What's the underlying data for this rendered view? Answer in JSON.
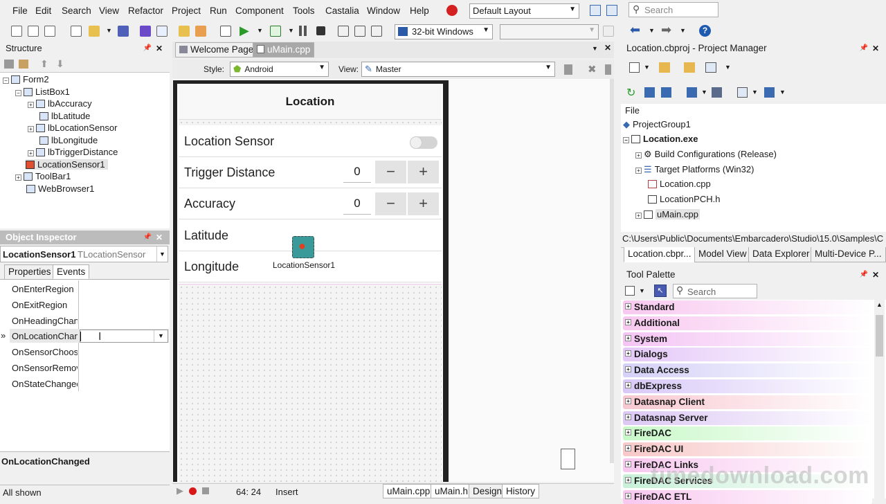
{
  "menubar": {
    "items": [
      "File",
      "Edit",
      "Search",
      "View",
      "Refactor",
      "Project",
      "Run",
      "Component",
      "Tools",
      "Castalia",
      "Window",
      "Help"
    ],
    "layout_combo": "Default Layout",
    "search_placeholder": "Search"
  },
  "toolbar": {
    "platform_combo": "32-bit Windows",
    "config_combo": ""
  },
  "structure": {
    "title": "Structure",
    "nodes": [
      "Form2",
      "ListBox1",
      "lbAccuracy",
      "lbLatitude",
      "lbLocationSensor",
      "lbLongitude",
      "lbTriggerDistance",
      "LocationSensor1",
      "ToolBar1",
      "WebBrowser1"
    ]
  },
  "inspector": {
    "title": "Object Inspector",
    "object_name": "LocationSensor1",
    "object_type": "TLocationSensor",
    "tab_properties": "Properties",
    "tab_events": "Events",
    "events": [
      "OnEnterRegion",
      "OnExitRegion",
      "OnHeadingChan",
      "OnLocationChan",
      "OnSensorChoos",
      "OnSensorRemov",
      "OnStateChangec"
    ],
    "selected_marker": "»",
    "selected_event_label": "OnLocationChanged",
    "status": "All shown"
  },
  "editor": {
    "tab_welcome": "Welcome Page",
    "tab_umain": "uMain.cpp",
    "style_label": "Style:",
    "style_value": "Android",
    "view_label": "View:",
    "view_value": "Master"
  },
  "form": {
    "header": "Location",
    "rows": {
      "location_sensor": "Location Sensor",
      "trigger_distance": "Trigger Distance",
      "trigger_value": "0",
      "accuracy": "Accuracy",
      "accuracy_value": "0",
      "latitude": "Latitude",
      "longitude": "Longitude"
    },
    "minus": "−",
    "plus": "+",
    "component_label": "LocationSensor1"
  },
  "statusbar": {
    "position": "64:  24",
    "mode": "Insert",
    "tabs": [
      "uMain.cpp",
      "uMain.h",
      "Design",
      "History"
    ]
  },
  "project_manager": {
    "title": "Location.cbproj - Project Manager",
    "column": "File",
    "nodes": [
      "ProjectGroup1",
      "Location.exe",
      "Build Configurations (Release)",
      "Target Platforms (Win32)",
      "Location.cpp",
      "LocationPCH.h",
      "uMain.cpp"
    ],
    "path": "C:\\Users\\Public\\Documents\\Embarcadero\\Studio\\15.0\\Samples\\C",
    "tabs": [
      "Location.cbpr...",
      "Model View",
      "Data Explorer",
      "Multi-Device P..."
    ]
  },
  "tool_palette": {
    "title": "Tool Palette",
    "search_placeholder": "Search",
    "categories": [
      {
        "name": "Standard",
        "color": "#f8c8f0"
      },
      {
        "name": "Additional",
        "color": "#f8c8f0"
      },
      {
        "name": "System",
        "color": "#f4c4f4"
      },
      {
        "name": "Dialogs",
        "color": "#e4c8f8"
      },
      {
        "name": "Data Access",
        "color": "#d4d0f8"
      },
      {
        "name": "dbExpress",
        "color": "#d8c8f8"
      },
      {
        "name": "Datasnap Client",
        "color": "#f8c8d0"
      },
      {
        "name": "Datasnap Server",
        "color": "#dcc8f4"
      },
      {
        "name": "FireDAC",
        "color": "#c8f8c8"
      },
      {
        "name": "FireDAC UI",
        "color": "#f8c8c8"
      },
      {
        "name": "FireDAC Links",
        "color": "#f8c8f0"
      },
      {
        "name": "FireDAC Services",
        "color": "#c8f0d8"
      },
      {
        "name": "FireDAC ETL",
        "color": "#f8c8f0"
      }
    ]
  },
  "watermark": "timedownload.com"
}
